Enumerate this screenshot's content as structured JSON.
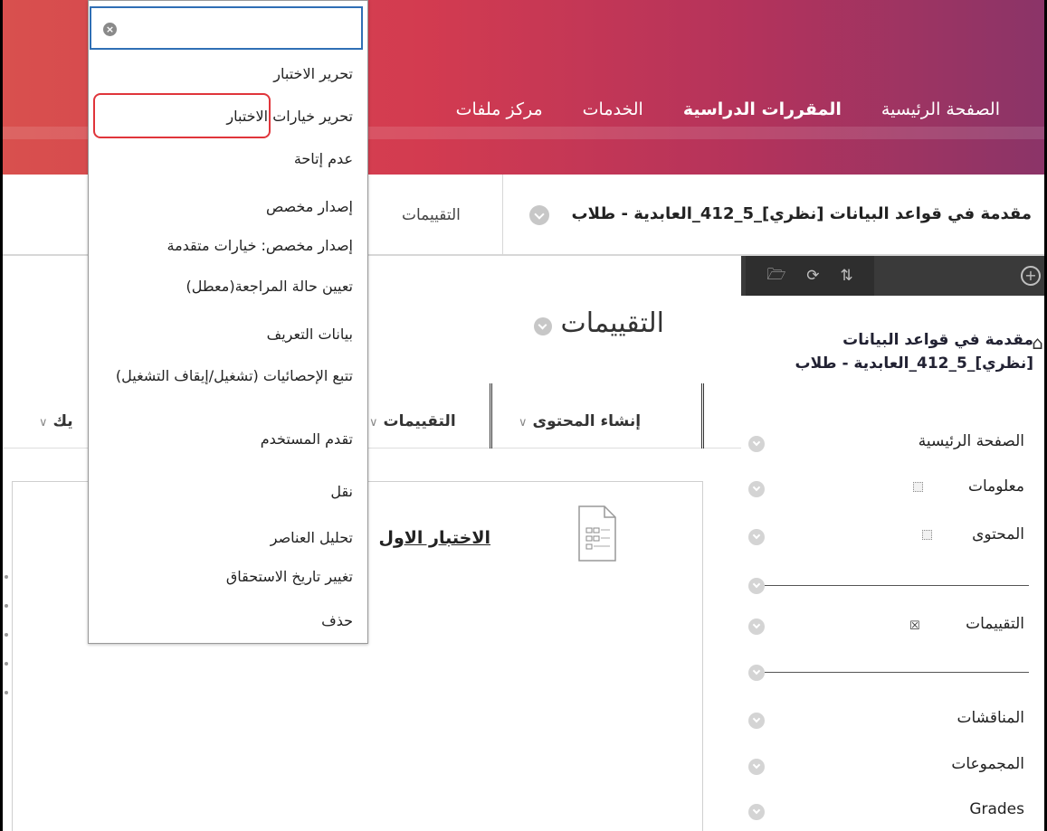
{
  "top_nav": {
    "items": [
      {
        "label": "الصفحة الرئيسية",
        "active": false
      },
      {
        "label": "المقررات الدراسية",
        "active": true
      },
      {
        "label": "الخدمات",
        "active": false
      },
      {
        "label": "مركز ملفات",
        "active": false
      }
    ]
  },
  "breadcrumb": {
    "course": "مقدمة في قواعد البيانات [نظري]_5_412_العابدية - طلاب",
    "current": "التقييمات"
  },
  "course_menu": {
    "title": "مقدمة في قواعد البيانات [نظري]_5_412_العابدية - طلاب",
    "items": {
      "home": "الصفحة الرئيسية",
      "info": "معلومات",
      "content": "المحتوى",
      "assessments": "التقييمات",
      "discussions": "المناقشات",
      "groups": "المجموعات",
      "grades": "Grades"
    }
  },
  "main": {
    "page_title": "التقييمات",
    "actions": {
      "build_content": "إنشاء المحتوى",
      "assessments": "التقييمات",
      "partial": "يك"
    },
    "test_title": "الاختبار الاول"
  },
  "context_menu": {
    "search_placeholder": "",
    "items": {
      "edit_test": "تحرير الاختبار",
      "edit_test_options": "تحرير خيارات الاختبار",
      "make_unavailable": "عدم إتاحة",
      "adaptive_release": "إصدار مخصص",
      "adaptive_release_advanced": "إصدار مخصص: خيارات متقدمة",
      "set_review_status": "تعيين حالة المراجعة(معطل)",
      "metadata": "بيانات التعريف",
      "statistics_tracking": "تتبع الإحصائيات (تشغيل/إيقاف التشغيل)",
      "user_progress": "تقدم المستخدم",
      "move": "نقل",
      "item_analysis": "تحليل العناصر",
      "change_due_date": "تغيير تاريخ الاستحقاق",
      "delete": "حذف"
    }
  },
  "colors": {
    "banner_start": "#d8504e",
    "banner_end": "#8a3468",
    "highlight": "#e0353b",
    "focus": "#2f6fb5"
  }
}
